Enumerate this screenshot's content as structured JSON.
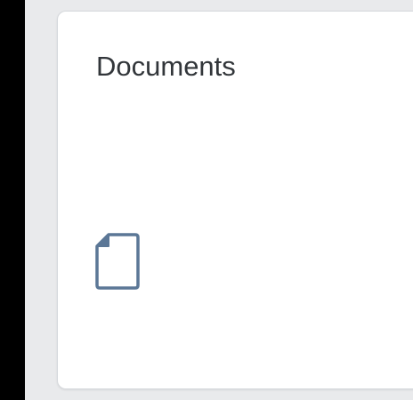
{
  "tile": {
    "title": "Documents",
    "icon": "document-icon"
  },
  "colors": {
    "background": "#000000",
    "canvas": "#e9eaec",
    "tile_background": "#ffffff",
    "tile_border": "#d5d8dc",
    "title_text": "#32363a",
    "icon_stroke": "#5b7796"
  }
}
